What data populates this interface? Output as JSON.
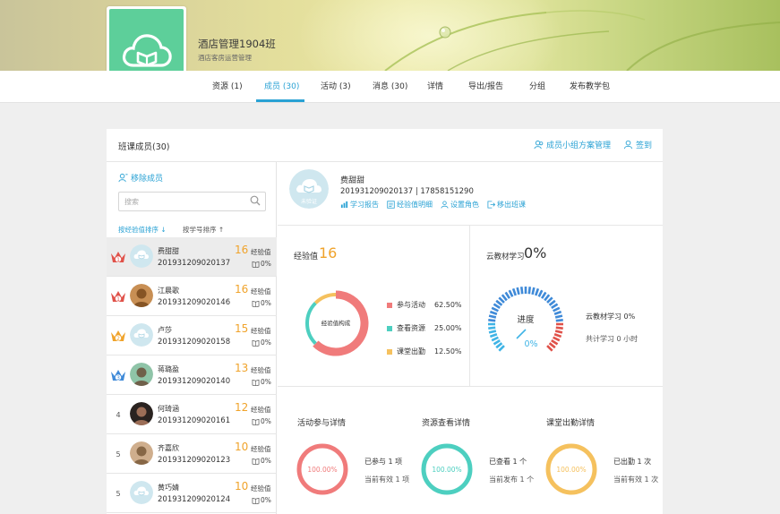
{
  "class": {
    "title": "酒店管理1904班",
    "subtitle": "酒店客房运营管理"
  },
  "tabs": [
    {
      "label": "资源 (1)"
    },
    {
      "label": "成员 (30)"
    },
    {
      "label": "活动 (3)"
    },
    {
      "label": "消息 (30)"
    },
    {
      "label": "详情"
    },
    {
      "label": "导出/报告"
    },
    {
      "label": "分组"
    },
    {
      "label": "发布教学包"
    }
  ],
  "panel": {
    "title": "班课成员(30)",
    "group_plan": "成员小组方案管理",
    "checkin": "签到",
    "remove_members": "移除成员",
    "search_placeholder": "搜索",
    "sort_exp": "按经验值排序 ↓",
    "sort_id": "按学号排序 ↑"
  },
  "members": [
    {
      "rank": "1",
      "name": "费甜甜",
      "id": "201931209020137",
      "score": "16",
      "score_label": "经验值",
      "pct": "0%"
    },
    {
      "rank": "1",
      "name": "江晨歌",
      "id": "201931209020146",
      "score": "16",
      "score_label": "经验值",
      "pct": "0%"
    },
    {
      "rank": "2",
      "name": "卢莎",
      "id": "201931209020158",
      "score": "15",
      "score_label": "经验值",
      "pct": "0%"
    },
    {
      "rank": "3",
      "name": "蒋璐盈",
      "id": "201931209020140",
      "score": "13",
      "score_label": "经验值",
      "pct": "0%"
    },
    {
      "rank": "4",
      "name": "何琦涵",
      "id": "201931209020161",
      "score": "12",
      "score_label": "经验值",
      "pct": "0%"
    },
    {
      "rank": "5",
      "name": "齐嘉欣",
      "id": "201931209020123",
      "score": "10",
      "score_label": "经验值",
      "pct": "0%"
    },
    {
      "rank": "5",
      "name": "黄巧婧",
      "id": "201931209020124",
      "score": "10",
      "score_label": "经验值",
      "pct": "0%"
    }
  ],
  "profile": {
    "name": "费甜甜",
    "id_phone": "201931209020137 | 17858151290",
    "links": [
      "学习报告",
      "经验值明细",
      "设置角色",
      "移出班课"
    ],
    "avatar_text": "未验证"
  },
  "experience": {
    "label": "经验值",
    "value": "16",
    "donut_center": "经验值构成",
    "legend": [
      {
        "label": "参与活动",
        "pct": "62.50%",
        "color": "#f07b7b",
        "value": 62.5
      },
      {
        "label": "查看资源",
        "pct": "25.00%",
        "color": "#4dcfc0",
        "value": 25.0
      },
      {
        "label": "课堂出勤",
        "pct": "12.50%",
        "color": "#f5c15e",
        "value": 12.5
      }
    ]
  },
  "cloud": {
    "label": "云教材学习",
    "value": "0%",
    "gauge_title": "进度",
    "gauge_value": "0%",
    "progress": 0,
    "line1": "云教材学习 0%",
    "line2": "共计学习 0 小时"
  },
  "details": [
    {
      "title": "活动参与详情",
      "ring_text": "100.00%",
      "color": "#f07b7b",
      "line1": "已参与 1 项",
      "line2": "当前有效 1 项"
    },
    {
      "title": "资源查看详情",
      "ring_text": "100.00%",
      "color": "#4dcfc0",
      "line1": "已查看 1 个",
      "line2": "当前发布 1 个"
    },
    {
      "title": "课堂出勤详情",
      "ring_text": "100.00%",
      "color": "#f5c15e",
      "line1": "已出勤 1 次",
      "line2": "当前有效 1 次"
    }
  ]
}
